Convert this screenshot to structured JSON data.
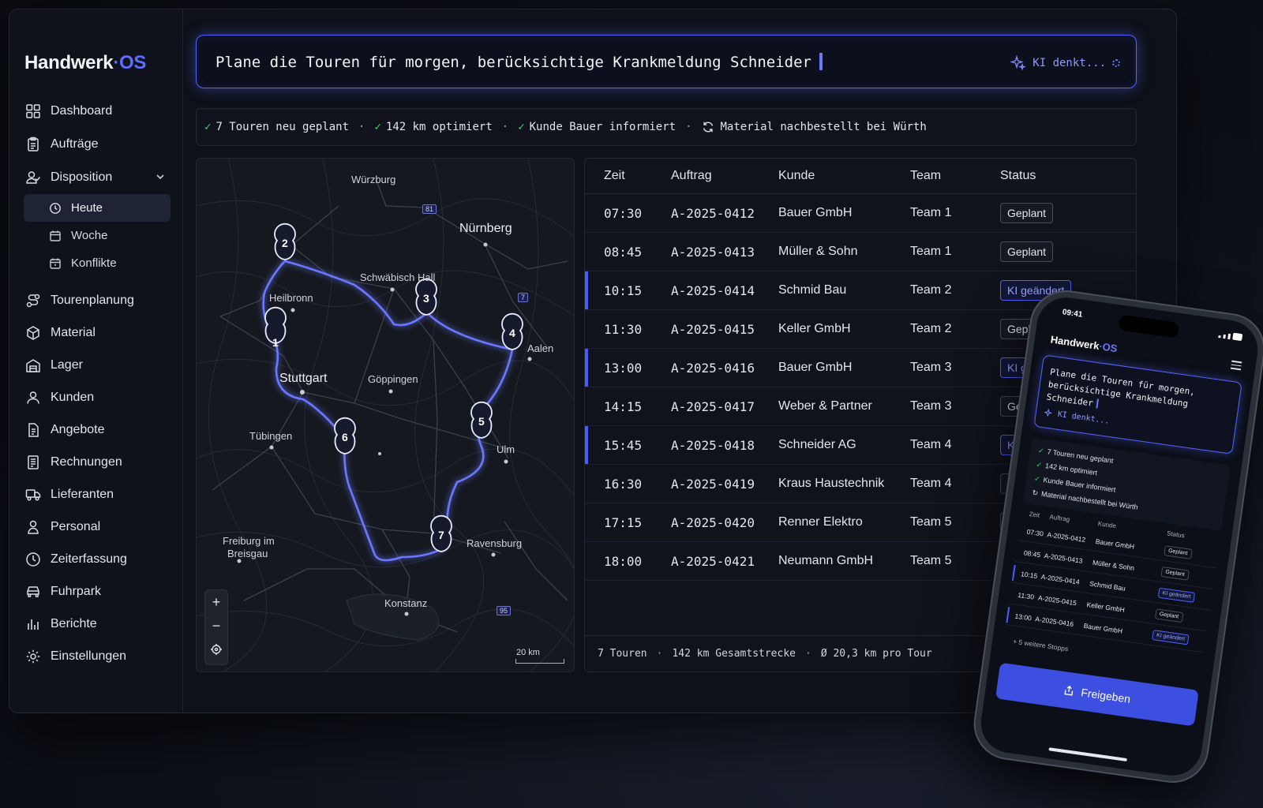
{
  "app": {
    "brand_main": "Handwerk",
    "brand_sep": "·",
    "brand_os": "OS",
    "accent": "#5b6cff",
    "success": "#3fd46a"
  },
  "sidebar": {
    "items": [
      {
        "label": "Dashboard",
        "icon": "grid-icon"
      },
      {
        "label": "Aufträge",
        "icon": "clipboard-icon"
      },
      {
        "label": "Disposition",
        "icon": "users-icon",
        "expanded": true
      },
      {
        "label": "Tourenplanung",
        "icon": "route-icon"
      },
      {
        "label": "Material",
        "icon": "box-icon"
      },
      {
        "label": "Lager",
        "icon": "warehouse-icon"
      },
      {
        "label": "Kunden",
        "icon": "user-icon"
      },
      {
        "label": "Angebote",
        "icon": "document-icon"
      },
      {
        "label": "Rechnungen",
        "icon": "invoice-icon"
      },
      {
        "label": "Lieferanten",
        "icon": "truck-icon"
      },
      {
        "label": "Personal",
        "icon": "person-icon"
      },
      {
        "label": "Zeiterfassung",
        "icon": "clock-icon"
      },
      {
        "label": "Fuhrpark",
        "icon": "car-icon"
      },
      {
        "label": "Berichte",
        "icon": "chart-icon"
      },
      {
        "label": "Einstellungen",
        "icon": "gear-icon"
      }
    ],
    "subitems": [
      {
        "label": "Heute",
        "icon": "clock-icon",
        "active": true
      },
      {
        "label": "Woche",
        "icon": "calendar-icon"
      },
      {
        "label": "Konflikte",
        "icon": "calendar-alert-icon"
      }
    ]
  },
  "prompt": {
    "text": "Plane die Touren für morgen, berücksichtige Krankmeldung Schneider",
    "status": "KI denkt..."
  },
  "summary": {
    "items": [
      "7 Touren neu geplant",
      "142 km optimiert",
      "Kunde Bauer informiert"
    ],
    "material": "Material nachbestellt bei Würth"
  },
  "map": {
    "cities": [
      "Würzburg",
      "Nürnberg",
      "Schwäbisch Hall",
      "Heilbronn",
      "Aalen",
      "Stuttgart",
      "Göppingen",
      "Tübingen",
      "Ulm",
      "Freiburg im",
      "Breisgau",
      "Ravensburg",
      "Konstanz"
    ],
    "shields": [
      "81",
      "7",
      "95"
    ],
    "markers": [
      "1",
      "2",
      "3",
      "4",
      "5",
      "6",
      "7"
    ],
    "scale": "20 km",
    "zoom_in": "+",
    "zoom_out": "−"
  },
  "table": {
    "headers": [
      "Zeit",
      "Auftrag",
      "Kunde",
      "Team",
      "Status"
    ],
    "rows": [
      {
        "time": "07:30",
        "order": "A-2025-0412",
        "customer": "Bauer GmbH",
        "team": "Team 1",
        "status": "Geplant",
        "ai": false
      },
      {
        "time": "08:45",
        "order": "A-2025-0413",
        "customer": "Müller & Sohn",
        "team": "Team 1",
        "status": "Geplant",
        "ai": false
      },
      {
        "time": "10:15",
        "order": "A-2025-0414",
        "customer": "Schmid Bau",
        "team": "Team 2",
        "status": "KI geändert",
        "ai": true
      },
      {
        "time": "11:30",
        "order": "A-2025-0415",
        "customer": "Keller GmbH",
        "team": "Team 2",
        "status": "Geplant",
        "ai": false
      },
      {
        "time": "13:00",
        "order": "A-2025-0416",
        "customer": "Bauer GmbH",
        "team": "Team 3",
        "status": "KI geändert",
        "ai": true
      },
      {
        "time": "14:15",
        "order": "A-2025-0417",
        "customer": "Weber & Partner",
        "team": "Team 3",
        "status": "Geplant",
        "ai": false
      },
      {
        "time": "15:45",
        "order": "A-2025-0418",
        "customer": "Schneider AG",
        "team": "Team 4",
        "status": "KI geändert",
        "ai": true
      },
      {
        "time": "16:30",
        "order": "A-2025-0419",
        "customer": "Kraus Haustechnik",
        "team": "Team 4",
        "status": "Geplant",
        "ai": false
      },
      {
        "time": "17:15",
        "order": "A-2025-0420",
        "customer": "Renner Elektro",
        "team": "Team 5",
        "status": "Geplant",
        "ai": false
      },
      {
        "time": "18:00",
        "order": "A-2025-0421",
        "customer": "Neumann GmbH",
        "team": "Team 5",
        "status": "Geplant",
        "ai": false
      }
    ],
    "footer": [
      "7 Touren",
      "142 km Gesamtstrecke",
      "Ø 20,3 km pro Tour"
    ]
  },
  "phone": {
    "time": "09:41",
    "prompt": "Plane die Touren für morgen, berücksichtige Krankmeldung Schneider",
    "status": "KI denkt...",
    "checks": [
      "7 Touren neu geplant",
      "142 km optimiert",
      "Kunde Bauer informiert"
    ],
    "material": "Material nachbestellt bei Würth",
    "headers": [
      "Zeit",
      "Auftrag",
      "Kunde",
      "Status"
    ],
    "rows": [
      {
        "time": "07:30",
        "order": "A-2025-0412",
        "customer": "Bauer GmbH",
        "status": "Geplant",
        "ai": false
      },
      {
        "time": "08:45",
        "order": "A-2025-0413",
        "customer": "Müller & Sohn",
        "status": "Geplant",
        "ai": false
      },
      {
        "time": "10:15",
        "order": "A-2025-0414",
        "customer": "Schmid Bau",
        "status": "KI geändert",
        "ai": true
      },
      {
        "time": "11:30",
        "order": "A-2025-0415",
        "customer": "Keller GmbH",
        "status": "Geplant",
        "ai": false
      },
      {
        "time": "13:00",
        "order": "A-2025-0416",
        "customer": "Bauer GmbH",
        "status": "KI geändert",
        "ai": true
      }
    ],
    "more": "+ 5 weitere Stopps",
    "button": "Freigeben"
  }
}
